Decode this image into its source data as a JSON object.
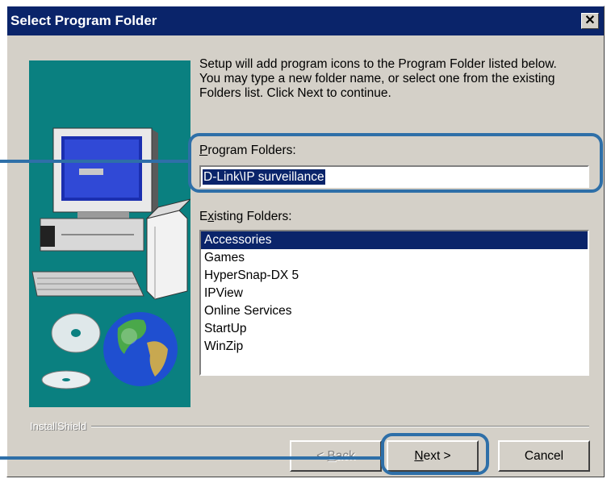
{
  "window": {
    "title": "Select Program Folder",
    "close_glyph": "✕"
  },
  "instructions": "Setup will add program icons to the Program Folder listed below.\nYou may type a new folder name, or select one from the existing\nFolders list.  Click Next to continue.",
  "program_folders": {
    "label_mnemonic": "P",
    "label_rest": "rogram Folders:",
    "value": "D-Link\\IP  surveillance"
  },
  "existing_folders": {
    "label_first": "E",
    "label_mnemonic": "x",
    "label_rest": "isting Folders:",
    "items": [
      "Accessories",
      "Games",
      "HyperSnap-DX 5",
      "IPView",
      "Online Services",
      "StartUp",
      "WinZip"
    ],
    "selected_index": 0
  },
  "brand": "InstallShield",
  "buttons": {
    "back_prefix": "< ",
    "back_mnemonic": "B",
    "back_rest": "ack",
    "next_mnemonic": "N",
    "next_rest": "ext >",
    "cancel": "Cancel"
  },
  "icons": {
    "close": "close-icon",
    "art": "computer-and-globe-illustration"
  },
  "colors": {
    "title_bar": "#0a246a",
    "face": "#d4d0c8",
    "selection": "#0a246a",
    "art_background": "#0a8080",
    "callout": "#2e6fa8"
  }
}
